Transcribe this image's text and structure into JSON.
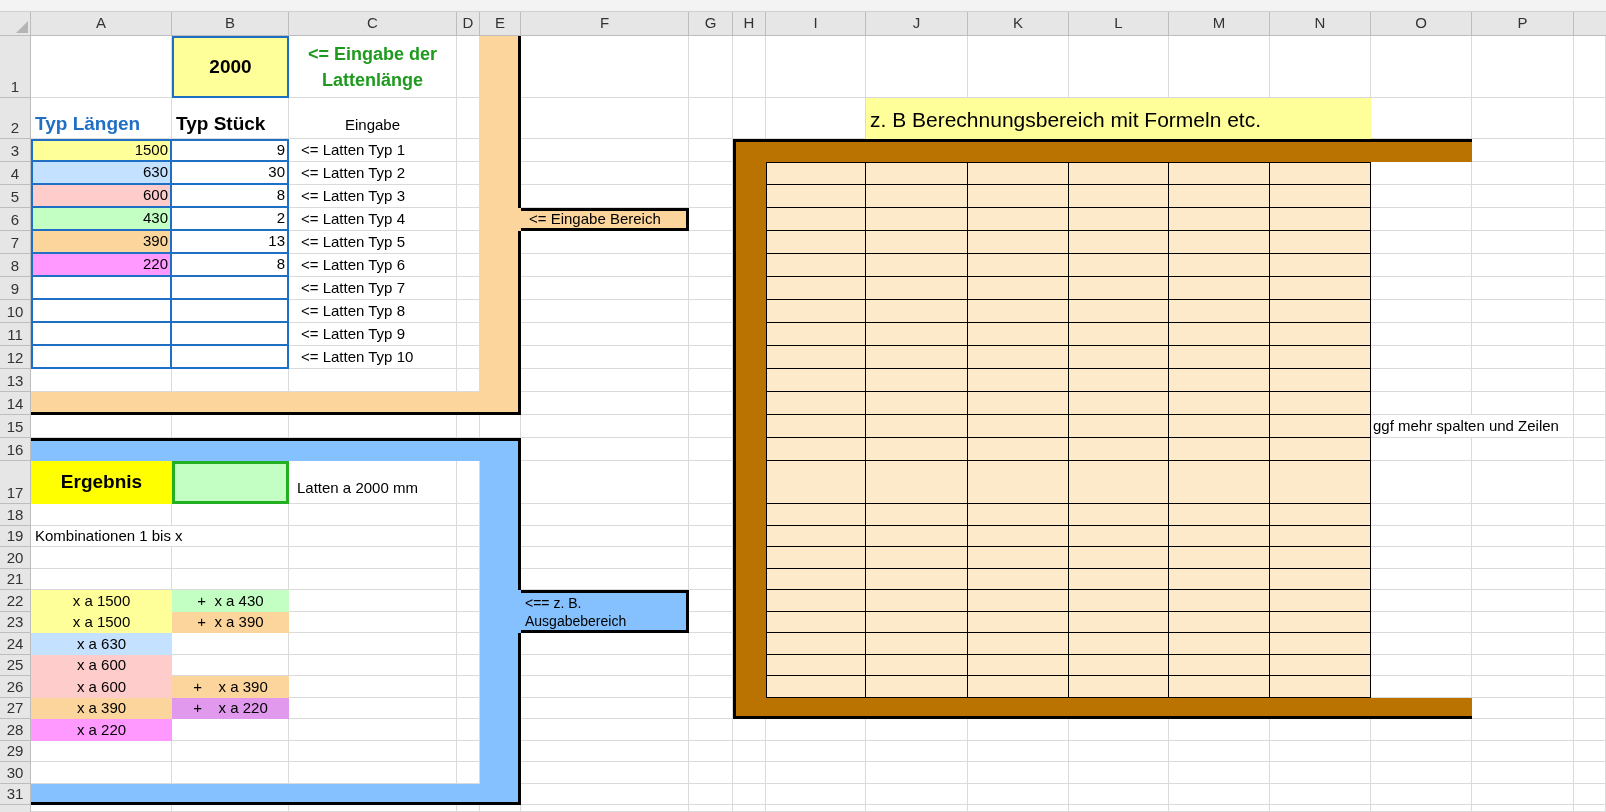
{
  "columns": [
    "A",
    "B",
    "C",
    "D",
    "E",
    "F",
    "G",
    "H",
    "I",
    "J",
    "K",
    "L",
    "M",
    "N",
    "O",
    "P"
  ],
  "rows": [
    "1",
    "2",
    "3",
    "4",
    "5",
    "6",
    "7",
    "8",
    "9",
    "10",
    "11",
    "12",
    "13",
    "14",
    "15",
    "16",
    "17",
    "18",
    "19",
    "20",
    "21",
    "22",
    "23",
    "24",
    "25",
    "26",
    "27",
    "28",
    "29",
    "30",
    "31"
  ],
  "length_input": {
    "value": "2000",
    "hint": "<= Eingabe der Lattenlänge"
  },
  "headers": {
    "lengths": "Typ Längen",
    "counts": "Typ Stück",
    "input": "Eingabe"
  },
  "types": [
    {
      "length": "1500",
      "count": "9",
      "label": "<= Latten Typ 1",
      "color": "#ffff99"
    },
    {
      "length": "630",
      "count": "30",
      "label": "<= Latten Typ 2",
      "color": "#c4e1ff"
    },
    {
      "length": "600",
      "count": "8",
      "label": "<= Latten Typ 3",
      "color": "#ffcccc"
    },
    {
      "length": "430",
      "count": "2",
      "label": "<= Latten Typ 4",
      "color": "#c3ffc3"
    },
    {
      "length": "390",
      "count": "13",
      "label": "<= Latten Typ 5",
      "color": "#fcd59c"
    },
    {
      "length": "220",
      "count": "8",
      "label": "<= Latten Typ 6",
      "color": "#ff99ff"
    },
    {
      "label": "<= Latten Typ 7"
    },
    {
      "label": "<= Latten Typ 8"
    },
    {
      "label": "<= Latten Typ 9"
    },
    {
      "label": "<= Latten Typ 10"
    }
  ],
  "input_area_label": "<= Eingabe Bereich",
  "result": {
    "label": "Ergebnis",
    "unit_label": "Latten a 2000 mm"
  },
  "combinations_title": "Kombinationen 1 bis x",
  "combinations": [
    {
      "first": {
        "text": "x a 1500",
        "color": "#ffff99"
      },
      "second": {
        "text": "+  x a 430",
        "color": "#c3ffc3"
      }
    },
    {
      "first": {
        "text": "x a 1500",
        "color": "#ffff99"
      },
      "second": {
        "text": "+  x a 390",
        "color": "#fcd59c"
      }
    },
    {
      "first": {
        "text": "x a 630",
        "color": "#c4e1ff"
      }
    },
    {
      "first": {
        "text": "x a 600",
        "color": "#ffcccc"
      }
    },
    {
      "first": {
        "text": "x a 600",
        "color": "#ffcccc"
      },
      "second": {
        "text": "+    x a 390",
        "color": "#fcd59c"
      }
    },
    {
      "first": {
        "text": "x a 390",
        "color": "#fcd59c"
      },
      "second": {
        "text": "+    x a 220",
        "color": "#e099ec"
      }
    },
    {
      "first": {
        "text": "x a 220",
        "color": "#ff99ff"
      }
    }
  ],
  "output_area_label": "<== z. B. Ausgabebereich",
  "calc_area": {
    "title": "z. B Berechnungsbereich mit Formeln etc.",
    "note": "ggf mehr spalten und Zeilen"
  }
}
